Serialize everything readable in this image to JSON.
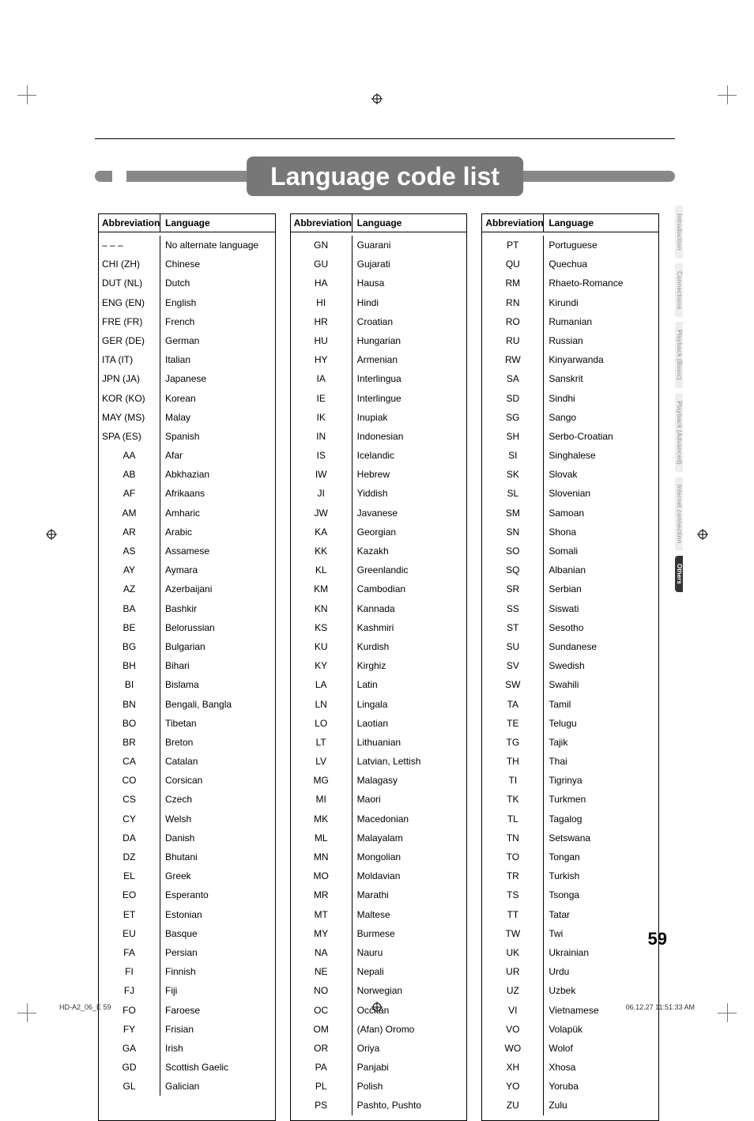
{
  "title": "Language code list",
  "headers": {
    "abbr": "Abbreviation",
    "lang": "Language"
  },
  "side_tabs": [
    "Introduction",
    "Connections",
    "Playback\n(Basic)",
    "Playback\n(Advanced)",
    "Internet\nconnection",
    "Others"
  ],
  "active_tab_index": 5,
  "page_number": "59",
  "footer_left": "HD-A2_06_E   59",
  "footer_right": "06.12.27   11:51:33 AM",
  "columns": [
    [
      {
        "abbr": "– – –",
        "lang": "No alternate language",
        "wide": true
      },
      {
        "abbr": "CHI (ZH)",
        "lang": "Chinese",
        "wide": true
      },
      {
        "abbr": "DUT (NL)",
        "lang": "Dutch",
        "wide": true
      },
      {
        "abbr": "ENG (EN)",
        "lang": "English",
        "wide": true
      },
      {
        "abbr": "FRE (FR)",
        "lang": "French",
        "wide": true
      },
      {
        "abbr": "GER (DE)",
        "lang": "German",
        "wide": true
      },
      {
        "abbr": "ITA (IT)",
        "lang": "Italian",
        "wide": true
      },
      {
        "abbr": "JPN (JA)",
        "lang": "Japanese",
        "wide": true
      },
      {
        "abbr": "KOR (KO)",
        "lang": "Korean",
        "wide": true
      },
      {
        "abbr": "MAY (MS)",
        "lang": "Malay",
        "wide": true
      },
      {
        "abbr": "SPA (ES)",
        "lang": "Spanish",
        "wide": true
      },
      {
        "abbr": "AA",
        "lang": "Afar"
      },
      {
        "abbr": "AB",
        "lang": "Abkhazian"
      },
      {
        "abbr": "AF",
        "lang": "Afrikaans"
      },
      {
        "abbr": "AM",
        "lang": "Amharic"
      },
      {
        "abbr": "AR",
        "lang": "Arabic"
      },
      {
        "abbr": "AS",
        "lang": "Assamese"
      },
      {
        "abbr": "AY",
        "lang": "Aymara"
      },
      {
        "abbr": "AZ",
        "lang": "Azerbaijani"
      },
      {
        "abbr": "BA",
        "lang": "Bashkir"
      },
      {
        "abbr": "BE",
        "lang": "Belorussian"
      },
      {
        "abbr": "BG",
        "lang": "Bulgarian"
      },
      {
        "abbr": "BH",
        "lang": "Bihari"
      },
      {
        "abbr": "BI",
        "lang": "Bislama"
      },
      {
        "abbr": "BN",
        "lang": "Bengali, Bangla"
      },
      {
        "abbr": "BO",
        "lang": "Tibetan"
      },
      {
        "abbr": "BR",
        "lang": "Breton"
      },
      {
        "abbr": "CA",
        "lang": "Catalan"
      },
      {
        "abbr": "CO",
        "lang": "Corsican"
      },
      {
        "abbr": "CS",
        "lang": "Czech"
      },
      {
        "abbr": "CY",
        "lang": "Welsh"
      },
      {
        "abbr": "DA",
        "lang": "Danish"
      },
      {
        "abbr": "DZ",
        "lang": "Bhutani"
      },
      {
        "abbr": "EL",
        "lang": "Greek"
      },
      {
        "abbr": "EO",
        "lang": "Esperanto"
      },
      {
        "abbr": "ET",
        "lang": "Estonian"
      },
      {
        "abbr": "EU",
        "lang": "Basque"
      },
      {
        "abbr": "FA",
        "lang": "Persian"
      },
      {
        "abbr": "FI",
        "lang": "Finnish"
      },
      {
        "abbr": "FJ",
        "lang": "Fiji"
      },
      {
        "abbr": "FO",
        "lang": "Faroese"
      },
      {
        "abbr": "FY",
        "lang": "Frisian"
      },
      {
        "abbr": "GA",
        "lang": "Irish"
      },
      {
        "abbr": "GD",
        "lang": "Scottish Gaelic"
      },
      {
        "abbr": "GL",
        "lang": "Galician"
      }
    ],
    [
      {
        "abbr": "GN",
        "lang": "Guarani"
      },
      {
        "abbr": "GU",
        "lang": "Gujarati"
      },
      {
        "abbr": "HA",
        "lang": "Hausa"
      },
      {
        "abbr": "HI",
        "lang": "Hindi"
      },
      {
        "abbr": "HR",
        "lang": "Croatian"
      },
      {
        "abbr": "HU",
        "lang": "Hungarian"
      },
      {
        "abbr": "HY",
        "lang": "Armenian"
      },
      {
        "abbr": "IA",
        "lang": "Interlingua"
      },
      {
        "abbr": "IE",
        "lang": "Interlingue"
      },
      {
        "abbr": "IK",
        "lang": "Inupiak"
      },
      {
        "abbr": "IN",
        "lang": "Indonesian"
      },
      {
        "abbr": "IS",
        "lang": "Icelandic"
      },
      {
        "abbr": "IW",
        "lang": "Hebrew"
      },
      {
        "abbr": "JI",
        "lang": "Yiddish"
      },
      {
        "abbr": "JW",
        "lang": "Javanese"
      },
      {
        "abbr": "KA",
        "lang": "Georgian"
      },
      {
        "abbr": "KK",
        "lang": "Kazakh"
      },
      {
        "abbr": "KL",
        "lang": "Greenlandic"
      },
      {
        "abbr": "KM",
        "lang": "Cambodian"
      },
      {
        "abbr": "KN",
        "lang": "Kannada"
      },
      {
        "abbr": "KS",
        "lang": "Kashmiri"
      },
      {
        "abbr": "KU",
        "lang": "Kurdish"
      },
      {
        "abbr": "KY",
        "lang": "Kirghiz"
      },
      {
        "abbr": "LA",
        "lang": "Latin"
      },
      {
        "abbr": "LN",
        "lang": "Lingala"
      },
      {
        "abbr": "LO",
        "lang": "Laotian"
      },
      {
        "abbr": "LT",
        "lang": "Lithuanian"
      },
      {
        "abbr": "LV",
        "lang": "Latvian, Lettish"
      },
      {
        "abbr": "MG",
        "lang": "Malagasy"
      },
      {
        "abbr": "MI",
        "lang": "Maori"
      },
      {
        "abbr": "MK",
        "lang": "Macedonian"
      },
      {
        "abbr": "ML",
        "lang": "Malayalam"
      },
      {
        "abbr": "MN",
        "lang": "Mongolian"
      },
      {
        "abbr": "MO",
        "lang": "Moldavian"
      },
      {
        "abbr": "MR",
        "lang": "Marathi"
      },
      {
        "abbr": "MT",
        "lang": "Maltese"
      },
      {
        "abbr": "MY",
        "lang": "Burmese"
      },
      {
        "abbr": "NA",
        "lang": "Nauru"
      },
      {
        "abbr": "NE",
        "lang": "Nepali"
      },
      {
        "abbr": "NO",
        "lang": "Norwegian"
      },
      {
        "abbr": "OC",
        "lang": "Occitan"
      },
      {
        "abbr": "OM",
        "lang": "(Afan) Oromo"
      },
      {
        "abbr": "OR",
        "lang": "Oriya"
      },
      {
        "abbr": "PA",
        "lang": "Panjabi"
      },
      {
        "abbr": "PL",
        "lang": "Polish"
      },
      {
        "abbr": "PS",
        "lang": "Pashto, Pushto"
      }
    ],
    [
      {
        "abbr": "PT",
        "lang": "Portuguese"
      },
      {
        "abbr": "QU",
        "lang": "Quechua"
      },
      {
        "abbr": "RM",
        "lang": "Rhaeto-Romance"
      },
      {
        "abbr": "RN",
        "lang": "Kirundi"
      },
      {
        "abbr": "RO",
        "lang": "Rumanian"
      },
      {
        "abbr": "RU",
        "lang": "Russian"
      },
      {
        "abbr": "RW",
        "lang": "Kinyarwanda"
      },
      {
        "abbr": "SA",
        "lang": "Sanskrit"
      },
      {
        "abbr": "SD",
        "lang": "Sindhi"
      },
      {
        "abbr": "SG",
        "lang": "Sango"
      },
      {
        "abbr": "SH",
        "lang": "Serbo-Croatian"
      },
      {
        "abbr": "SI",
        "lang": "Singhalese"
      },
      {
        "abbr": "SK",
        "lang": "Slovak"
      },
      {
        "abbr": "SL",
        "lang": "Slovenian"
      },
      {
        "abbr": "SM",
        "lang": "Samoan"
      },
      {
        "abbr": "SN",
        "lang": "Shona"
      },
      {
        "abbr": "SO",
        "lang": "Somali"
      },
      {
        "abbr": "SQ",
        "lang": "Albanian"
      },
      {
        "abbr": "SR",
        "lang": "Serbian"
      },
      {
        "abbr": "SS",
        "lang": "Siswati"
      },
      {
        "abbr": "ST",
        "lang": "Sesotho"
      },
      {
        "abbr": "SU",
        "lang": "Sundanese"
      },
      {
        "abbr": "SV",
        "lang": "Swedish"
      },
      {
        "abbr": "SW",
        "lang": "Swahili"
      },
      {
        "abbr": "TA",
        "lang": "Tamil"
      },
      {
        "abbr": "TE",
        "lang": "Telugu"
      },
      {
        "abbr": "TG",
        "lang": "Tajik"
      },
      {
        "abbr": "TH",
        "lang": "Thai"
      },
      {
        "abbr": "TI",
        "lang": "Tigrinya"
      },
      {
        "abbr": "TK",
        "lang": "Turkmen"
      },
      {
        "abbr": "TL",
        "lang": "Tagalog"
      },
      {
        "abbr": "TN",
        "lang": "Setswana"
      },
      {
        "abbr": "TO",
        "lang": "Tongan"
      },
      {
        "abbr": "TR",
        "lang": "Turkish"
      },
      {
        "abbr": "TS",
        "lang": "Tsonga"
      },
      {
        "abbr": "TT",
        "lang": "Tatar"
      },
      {
        "abbr": "TW",
        "lang": "Twi"
      },
      {
        "abbr": "UK",
        "lang": "Ukrainian"
      },
      {
        "abbr": "UR",
        "lang": "Urdu"
      },
      {
        "abbr": "UZ",
        "lang": "Uzbek"
      },
      {
        "abbr": "VI",
        "lang": "Vietnamese"
      },
      {
        "abbr": "VO",
        "lang": "Volapük"
      },
      {
        "abbr": "WO",
        "lang": "Wolof"
      },
      {
        "abbr": "XH",
        "lang": "Xhosa"
      },
      {
        "abbr": "YO",
        "lang": "Yoruba"
      },
      {
        "abbr": "ZU",
        "lang": "Zulu"
      }
    ]
  ]
}
